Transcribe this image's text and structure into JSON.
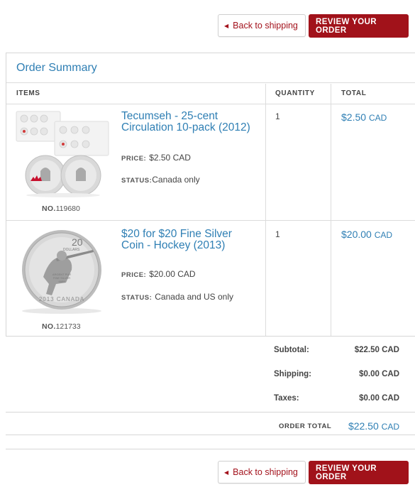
{
  "actions": {
    "back_label": "Back to shipping",
    "review_label": "REVIEW YOUR ORDER"
  },
  "summary": {
    "title": "Order Summary",
    "columns": {
      "items": "ITEMS",
      "quantity": "QUANTITY",
      "total": "TOTAL"
    },
    "items": [
      {
        "name": "Tecumseh - 25-cent Circulation 10-pack (2012)",
        "price_key": "PRICE:",
        "price": "$2.50 CAD",
        "status_key": "STATUS:",
        "status": "Canada only",
        "no_key": "NO.",
        "no": "119680",
        "quantity": "1",
        "total": "$2.50",
        "total_currency": "CAD"
      },
      {
        "name": "$20 for $20 Fine Silver Coin - Hockey (2013)",
        "price_key": "PRICE:",
        "price": "$20.00 CAD",
        "status_key": "STATUS:",
        "status": "Canada and US only",
        "no_key": "NO.",
        "no": "121733",
        "quantity": "1",
        "total": "$20.00",
        "total_currency": "CAD",
        "coin_text": {
          "denomination": "20",
          "unit": "DOLLARS",
          "inner1": "ARGENT PUR",
          "inner2": "FINE SILVER",
          "inner3": "9999",
          "rim": "2013 CANADA"
        }
      }
    ]
  },
  "totals": {
    "subtotal_label": "Subtotal:",
    "subtotal": "$22.50 CAD",
    "shipping_label": "Shipping:",
    "shipping": "$0.00 CAD",
    "taxes_label": "Taxes:",
    "taxes": "$0.00 CAD",
    "order_total_label": "ORDER TOTAL",
    "order_total": "$22.50",
    "order_total_currency": "CAD"
  },
  "colors": {
    "accent": "#a1121a",
    "link": "#2f7fb4",
    "border": "#d6d6d6"
  }
}
